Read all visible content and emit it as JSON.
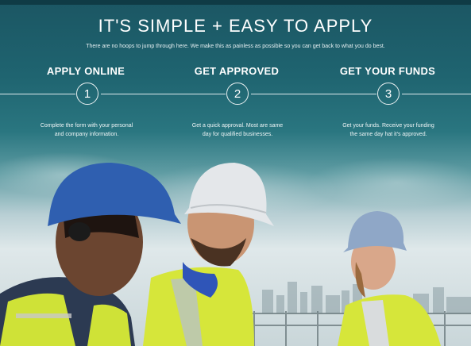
{
  "header": {
    "title": "IT'S SIMPLE + EASY TO APPLY",
    "subtitle": "There are no hoops to jump through here. We make this as painless as possible so you can get back to what you do best."
  },
  "steps": [
    {
      "number": "1",
      "title": "APPLY ONLINE",
      "description_line1": "Complete the form with your personal",
      "description_line2": "and company information."
    },
    {
      "number": "2",
      "title": "GET APPROVED",
      "description_line1": "Get a quick approval. Most are same",
      "description_line2": "day for qualified businesses."
    },
    {
      "number": "3",
      "title": "GET YOUR FUNDS",
      "description_line1": "Get your funds. Receive your funding",
      "description_line2": "the same day hat it's approved."
    }
  ],
  "colors": {
    "header_bg": "#1b5663",
    "vest": "#d6e63a",
    "helmet_blue": "#2f5fb0",
    "helmet_white": "#e4e7ea"
  }
}
